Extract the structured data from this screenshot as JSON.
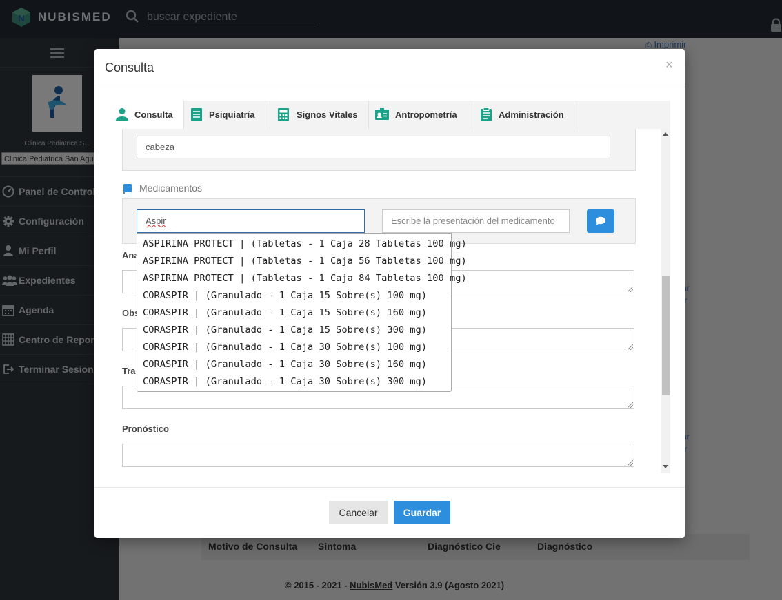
{
  "topbar": {
    "brand": "NUBISMED",
    "search_placeholder": "buscar expediente"
  },
  "sidebar": {
    "clinic_short": "Clinica Pediatrica S...",
    "clinic_select": "Clinica Pediatrica San Agu",
    "items": [
      {
        "label": "Panel de Control",
        "icon": "dashboard-icon"
      },
      {
        "label": "Configuración",
        "icon": "gear-icon"
      },
      {
        "label": "Mi Perfil",
        "icon": "user-icon"
      },
      {
        "label": "Expedientes",
        "icon": "users-icon"
      },
      {
        "label": "Agenda",
        "icon": "calendar-icon"
      },
      {
        "label": "Centro de Reportes",
        "icon": "report-icon"
      },
      {
        "label": "Terminar Sesion",
        "icon": "logout-icon"
      }
    ]
  },
  "background": {
    "print_link": "Imprimir",
    "right_cells_1": [
      "a",
      "car",
      "nir"
    ],
    "right_cells_2": [
      "a",
      "car",
      "nir"
    ],
    "table_headers": [
      "Motivo de Consulta",
      "Sintoma",
      "Diagnóstico Cie",
      "Diagnóstico"
    ],
    "footer_prefix": "© 2015 - 2021 - ",
    "footer_link": "NubisMed",
    "footer_suffix": " Versión 3.9 (Agosto 2021)"
  },
  "modal": {
    "title": "Consulta",
    "close": "×",
    "tabs": [
      {
        "label": "Consulta",
        "icon": "user-icon",
        "active": true
      },
      {
        "label": "Psiquiatría",
        "icon": "document-icon"
      },
      {
        "label": "Signos Vitales",
        "icon": "calculator-icon"
      },
      {
        "label": "Antropometría",
        "icon": "id-card-icon"
      },
      {
        "label": "Administración",
        "icon": "clipboard-icon"
      }
    ],
    "sintoma_value": "cabeza",
    "medicamentos_label": "Medicamentos",
    "med_input_value": "Aspir",
    "presentation_placeholder": "Escribe la presentación del medicamento",
    "fields": {
      "analisis": "Ana",
      "observaciones": "Obs",
      "tratamiento": "Tra",
      "pronostico": "Pronóstico"
    },
    "cancel_label": "Cancelar",
    "save_label": "Guardar",
    "accent_color": "#2d8ede"
  },
  "autocomplete": [
    "ASPIRINA PROTECT | (Tabletas - 1 Caja 28 Tabletas 100 mg)",
    "ASPIRINA PROTECT | (Tabletas - 1 Caja 56 Tabletas 100 mg)",
    "ASPIRINA PROTECT | (Tabletas - 1 Caja 84 Tabletas 100 mg)",
    "CORASPIR | (Granulado - 1 Caja 15 Sobre(s) 100 mg)",
    "CORASPIR | (Granulado - 1 Caja 15 Sobre(s) 160 mg)",
    "CORASPIR | (Granulado - 1 Caja 15 Sobre(s) 300 mg)",
    "CORASPIR | (Granulado - 1 Caja 30 Sobre(s) 100 mg)",
    "CORASPIR | (Granulado - 1 Caja 30 Sobre(s) 160 mg)",
    "CORASPIR | (Granulado - 1 Caja 30 Sobre(s) 300 mg)"
  ]
}
